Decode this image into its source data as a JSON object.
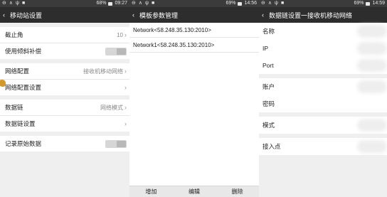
{
  "status": {
    "left_icons": [
      "⊖",
      "∧",
      "ψ",
      "■"
    ],
    "s1_right": "68%",
    "s1_time": "09:27",
    "s2_right": "69%",
    "s2_time": "14:56",
    "s3_right": "69%",
    "s3_time": "14:59"
  },
  "screen1": {
    "title": "移动站设置",
    "rows": {
      "cutoff_label": "截止角",
      "cutoff_value": "10",
      "tilt_label": "使用倾斜补偿",
      "net_config_label": "网络配置",
      "net_config_value": "接收机移动网络",
      "net_settings_label": "网络配置设置",
      "datalink_label": "数据链",
      "datalink_value": "网络模式",
      "datalink_settings_label": "数据链设置",
      "record_raw_label": "记录原始数据"
    }
  },
  "screen2": {
    "title": "模板参数管理",
    "items": [
      "Network<58.248.35.130:2010>",
      "Network1<58.248.35.130:2010>"
    ],
    "buttons": {
      "add": "增加",
      "edit": "编辑",
      "delete": "删除"
    }
  },
  "screen3": {
    "title": "数据链设置一接收机移动网络",
    "fields": {
      "name": "名称",
      "ip": "IP",
      "port": "Port",
      "account": "账户",
      "password": "密码",
      "mode": "模式",
      "access_point": "接入点"
    }
  }
}
